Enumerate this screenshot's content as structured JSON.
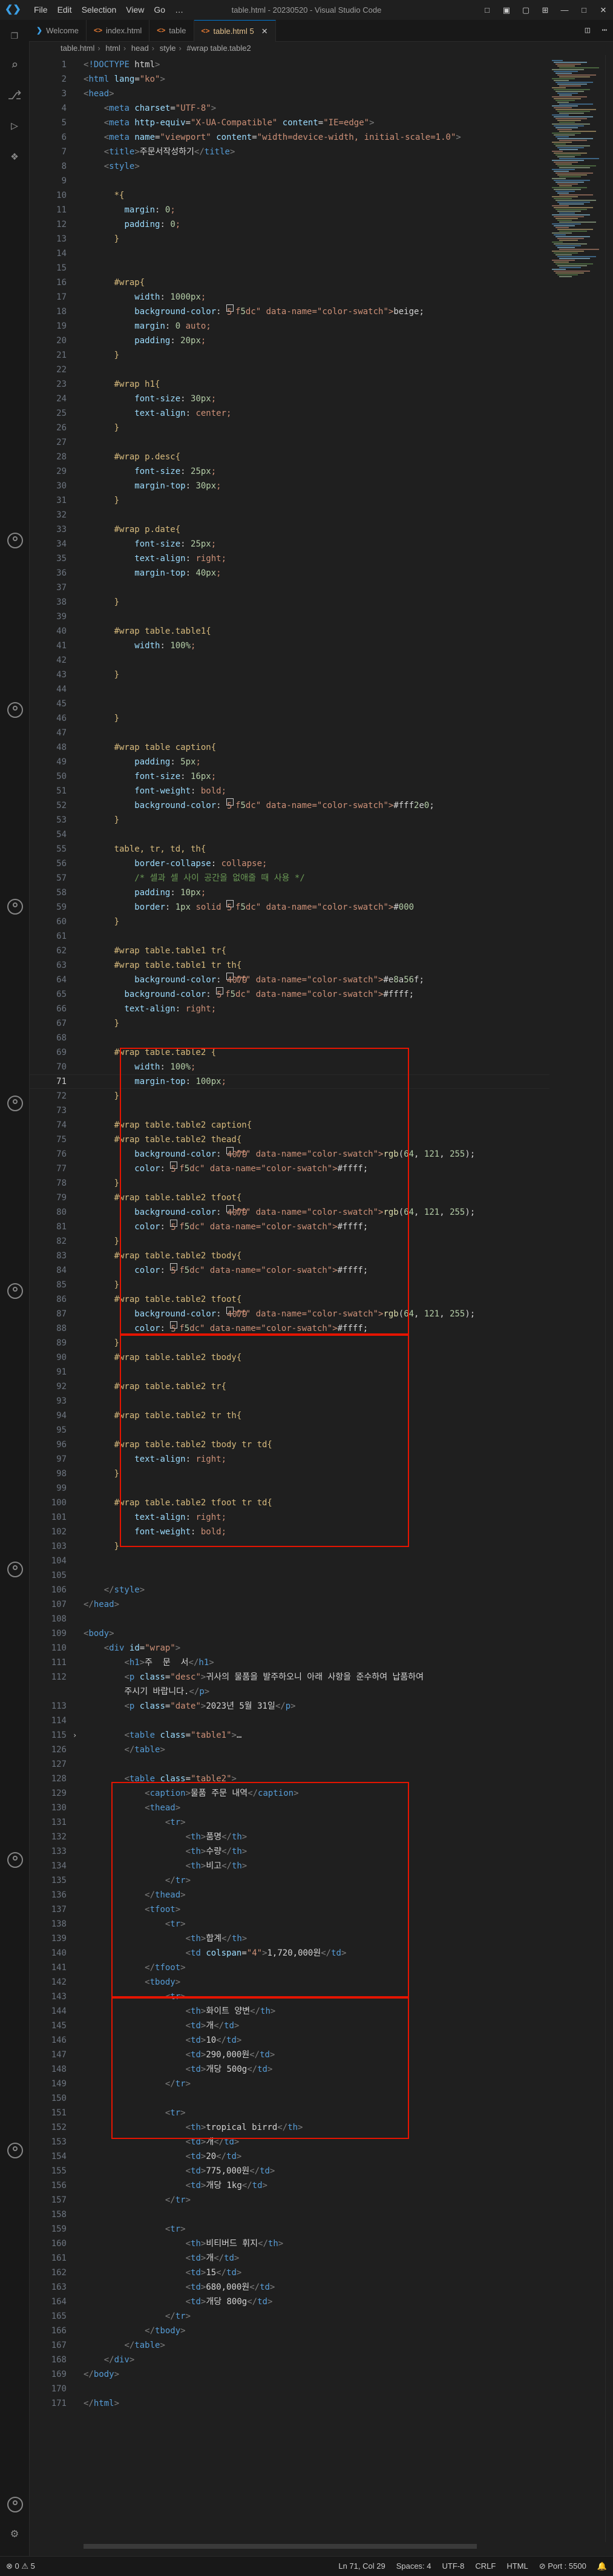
{
  "titlebar": {
    "menu": [
      "File",
      "Edit",
      "Selection",
      "View",
      "Go",
      "…"
    ],
    "title": "table.html - 20230520 - Visual Studio Code"
  },
  "tabs": [
    {
      "label": "Welcome",
      "icon": "vscode-icon"
    },
    {
      "label": "index.html",
      "icon": "html-file-icon"
    },
    {
      "label": "table",
      "icon": "html-file-icon"
    },
    {
      "label": "table.html 5",
      "icon": "html-file-icon",
      "active": true
    }
  ],
  "breadcrumb": [
    "table.html",
    "html",
    "head",
    "style",
    "#wrap table.table2"
  ],
  "editor": {
    "lines": [
      {
        "n": "1",
        "t": "<!DOCTYPE html>"
      },
      {
        "n": "2",
        "t": "<html lang=\"ko\">"
      },
      {
        "n": "3",
        "t": "<head>"
      },
      {
        "n": "4",
        "t": "    <meta charset=\"UTF-8\">"
      },
      {
        "n": "5",
        "t": "    <meta http-equiv=\"X-UA-Compatible\" content=\"IE=edge\">"
      },
      {
        "n": "6",
        "t": "    <meta name=\"viewport\" content=\"width=device-width, initial-scale=1.0\">"
      },
      {
        "n": "7",
        "t": "    <title>주문서작성하기</title>"
      },
      {
        "n": "8",
        "t": "    <style>"
      },
      {
        "n": "9",
        "t": ""
      },
      {
        "n": "10",
        "t": "      *{"
      },
      {
        "n": "11",
        "t": "        margin: 0;"
      },
      {
        "n": "12",
        "t": "        padding: 0;"
      },
      {
        "n": "13",
        "t": "      }"
      },
      {
        "n": "14",
        "t": ""
      },
      {
        "n": "15",
        "t": ""
      },
      {
        "n": "16",
        "t": "      #wrap{"
      },
      {
        "n": "17",
        "t": "          width: 1000px;"
      },
      {
        "n": "18",
        "t": "          background-color: □beige;"
      },
      {
        "n": "19",
        "t": "          margin: 0 auto;"
      },
      {
        "n": "20",
        "t": "          padding: 20px;"
      },
      {
        "n": "21",
        "t": "      }"
      },
      {
        "n": "22",
        "t": ""
      },
      {
        "n": "23",
        "t": "      #wrap h1{"
      },
      {
        "n": "24",
        "t": "          font-size: 30px;"
      },
      {
        "n": "25",
        "t": "          text-align: center;"
      },
      {
        "n": "26",
        "t": "      }"
      },
      {
        "n": "27",
        "t": ""
      },
      {
        "n": "28",
        "t": "      #wrap p.desc{"
      },
      {
        "n": "29",
        "t": "          font-size: 25px;"
      },
      {
        "n": "30",
        "t": "          margin-top: 30px;"
      },
      {
        "n": "31",
        "t": "      }"
      },
      {
        "n": "32",
        "t": ""
      },
      {
        "n": "33",
        "t": "      #wrap p.date{"
      },
      {
        "n": "34",
        "t": "          font-size: 25px;"
      },
      {
        "n": "35",
        "t": "          text-align: right;"
      },
      {
        "n": "36",
        "t": "          margin-top: 40px;"
      },
      {
        "n": "37",
        "t": ""
      },
      {
        "n": "38",
        "t": "      }"
      },
      {
        "n": "39",
        "t": ""
      },
      {
        "n": "40",
        "t": "      #wrap table.table1{"
      },
      {
        "n": "41",
        "t": "          width: 100%;"
      },
      {
        "n": "42",
        "t": ""
      },
      {
        "n": "43",
        "t": "      }"
      },
      {
        "n": "44",
        "t": ""
      },
      {
        "n": "45",
        "t": ""
      },
      {
        "n": "46",
        "t": "      }"
      },
      {
        "n": "47",
        "t": ""
      },
      {
        "n": "48",
        "t": "      #wrap table caption{"
      },
      {
        "n": "49",
        "t": "          padding: 5px;"
      },
      {
        "n": "50",
        "t": "          font-size: 16px;"
      },
      {
        "n": "51",
        "t": "          font-weight: bold;"
      },
      {
        "n": "52",
        "t": "          background-color: □#fff2e0;"
      },
      {
        "n": "53",
        "t": "      }"
      },
      {
        "n": "54",
        "t": ""
      },
      {
        "n": "55",
        "t": "      table, tr, td, th{"
      },
      {
        "n": "56",
        "t": "          border-collapse: collapse;"
      },
      {
        "n": "57",
        "t": "          /* 셀과 셀 사이 공간을 없애줄 때 사용 */"
      },
      {
        "n": "58",
        "t": "          padding: 10px;"
      },
      {
        "n": "59",
        "t": "          border: 1px solid □#000"
      },
      {
        "n": "60",
        "t": "      }"
      },
      {
        "n": "61",
        "t": ""
      },
      {
        "n": "62",
        "t": "      #wrap table.table1 tr{"
      },
      {
        "n": "63",
        "t": "      #wrap table.table1 tr th{"
      },
      {
        "n": "64",
        "t": "          background-color: ■#e8a56f;"
      },
      {
        "n": "65",
        "t": "        background-color: □#ffff;"
      },
      {
        "n": "66",
        "t": "        text-align: right;"
      },
      {
        "n": "67",
        "t": "      }"
      },
      {
        "n": "68",
        "t": ""
      },
      {
        "n": "69",
        "t": "      #wrap table.table2 {"
      },
      {
        "n": "70",
        "t": "          width: 100%;"
      },
      {
        "n": "71",
        "t": "          margin-top: 100px;"
      },
      {
        "n": "72",
        "t": "      }"
      },
      {
        "n": "73",
        "t": ""
      },
      {
        "n": "74",
        "t": "      #wrap table.table2 caption{"
      },
      {
        "n": "75",
        "t": "      #wrap table.table2 thead{"
      },
      {
        "n": "76",
        "t": "          background-color: ■rgb(64, 121, 255);"
      },
      {
        "n": "77",
        "t": "          color: □#ffff;"
      },
      {
        "n": "78",
        "t": "      }"
      },
      {
        "n": "79",
        "t": "      #wrap table.table2 tfoot{"
      },
      {
        "n": "80",
        "t": "          background-color: ■rgb(64, 121, 255);"
      },
      {
        "n": "81",
        "t": "          color: □#ffff;"
      },
      {
        "n": "82",
        "t": "      }"
      },
      {
        "n": "83",
        "t": "      #wrap table.table2 tbody{"
      },
      {
        "n": "84",
        "t": "          color: □#ffff;"
      },
      {
        "n": "85",
        "t": "      }"
      },
      {
        "n": "86",
        "t": "      #wrap table.table2 tfoot{"
      },
      {
        "n": "87",
        "t": "          background-color: ■rgb(64, 121, 255);"
      },
      {
        "n": "88",
        "t": "          color: □#ffff;"
      },
      {
        "n": "89",
        "t": "      }"
      },
      {
        "n": "90",
        "t": "      #wrap table.table2 tbody{"
      },
      {
        "n": "91",
        "t": ""
      },
      {
        "n": "92",
        "t": "      #wrap table.table2 tr{"
      },
      {
        "n": "93",
        "t": ""
      },
      {
        "n": "94",
        "t": "      #wrap table.table2 tr th{"
      },
      {
        "n": "95",
        "t": ""
      },
      {
        "n": "96",
        "t": "      #wrap table.table2 tbody tr td{"
      },
      {
        "n": "97",
        "t": "          text-align: right;"
      },
      {
        "n": "98",
        "t": "      }"
      },
      {
        "n": "99",
        "t": ""
      },
      {
        "n": "100",
        "t": "      #wrap table.table2 tfoot tr td{"
      },
      {
        "n": "101",
        "t": "          text-align: right;"
      },
      {
        "n": "102",
        "t": "          font-weight: bold;"
      },
      {
        "n": "103",
        "t": "      }"
      },
      {
        "n": "104",
        "t": ""
      },
      {
        "n": "105",
        "t": ""
      },
      {
        "n": "106",
        "t": "    </style>"
      },
      {
        "n": "107",
        "t": "</head>"
      },
      {
        "n": "108",
        "t": ""
      },
      {
        "n": "109",
        "t": "<body>"
      },
      {
        "n": "110",
        "t": "    <div id=\"wrap\">"
      },
      {
        "n": "111",
        "t": "        <h1>주  문  서</h1>"
      },
      {
        "n": "112",
        "t": "        <p class=\"desc\">귀사의 물품을 발주하오니 아래 사항을 준수하여 납품하여"
      },
      {
        "n": "",
        "t": "        주시기 바랍니다.</p>"
      },
      {
        "n": "113",
        "t": "        <p class=\"date\">2023년 5월 31일</p>"
      },
      {
        "n": "114",
        "t": ""
      },
      {
        "n": "115",
        "t": "        <table class=\"table1\">…"
      },
      {
        "n": "126",
        "t": "        </table>"
      },
      {
        "n": "127",
        "t": ""
      },
      {
        "n": "128",
        "t": "        <table class=\"table2\">"
      },
      {
        "n": "129",
        "t": "            <caption>물품 주문 내역</caption>"
      },
      {
        "n": "130",
        "t": "            <thead>"
      },
      {
        "n": "131",
        "t": "                <tr>"
      },
      {
        "n": "132",
        "t": "                    <th>품명</th>"
      },
      {
        "n": "133",
        "t": "                    <th>수량</th>"
      },
      {
        "n": "134",
        "t": "                    <th>비고</th>"
      },
      {
        "n": "135",
        "t": "                </tr>"
      },
      {
        "n": "136",
        "t": "            </thead>"
      },
      {
        "n": "137",
        "t": "            <tfoot>"
      },
      {
        "n": "138",
        "t": "                <tr>"
      },
      {
        "n": "139",
        "t": "                    <th>합계</th>"
      },
      {
        "n": "140",
        "t": "                    <td colspan=\"4\">1,720,000원</td>"
      },
      {
        "n": "141",
        "t": "            </tfoot>"
      },
      {
        "n": "142",
        "t": "            <tbody>"
      },
      {
        "n": "143",
        "t": "                <tr>"
      },
      {
        "n": "144",
        "t": "                    <th>화이트 양변</th>"
      },
      {
        "n": "145",
        "t": "                    <td>개</td>"
      },
      {
        "n": "146",
        "t": "                    <td>10</td>"
      },
      {
        "n": "147",
        "t": "                    <td>290,000원</td>"
      },
      {
        "n": "148",
        "t": "                    <td>개당 500g</td>"
      },
      {
        "n": "149",
        "t": "                </tr>"
      },
      {
        "n": "150",
        "t": ""
      },
      {
        "n": "151",
        "t": "                <tr>"
      },
      {
        "n": "152",
        "t": "                    <th>tropical birrd</th>"
      },
      {
        "n": "153",
        "t": "                    <td>개</td>"
      },
      {
        "n": "154",
        "t": "                    <td>20</td>"
      },
      {
        "n": "155",
        "t": "                    <td>775,000원</td>"
      },
      {
        "n": "156",
        "t": "                    <td>개당 1kg</td>"
      },
      {
        "n": "157",
        "t": "                </tr>"
      },
      {
        "n": "158",
        "t": ""
      },
      {
        "n": "159",
        "t": "                <tr>"
      },
      {
        "n": "160",
        "t": "                    <th>비티버드 휘지</th>"
      },
      {
        "n": "161",
        "t": "                    <td>개</td>"
      },
      {
        "n": "162",
        "t": "                    <td>15</td>"
      },
      {
        "n": "163",
        "t": "                    <td>680,000원</td>"
      },
      {
        "n": "164",
        "t": "                    <td>개당 800g</td>"
      },
      {
        "n": "165",
        "t": "                </tr>"
      },
      {
        "n": "166",
        "t": "            </tbody>"
      },
      {
        "n": "167",
        "t": "        </table>"
      },
      {
        "n": "168",
        "t": "    </div>"
      },
      {
        "n": "169",
        "t": "</body>"
      },
      {
        "n": "170",
        "t": ""
      },
      {
        "n": "171",
        "t": "</html>"
      }
    ],
    "current_line": "71"
  },
  "statusbar": {
    "left": [
      "⊗ 0  ⚠ 5"
    ],
    "right": [
      "Ln 71, Col 29",
      "Spaces: 4",
      "UTF-8",
      "CRLF",
      "HTML",
      "⊘ Port : 5500",
      "🔔"
    ]
  },
  "colors": {
    "accent": "#0078d4",
    "highlight_box": "#e51400",
    "swatch_beige": "#f5f5dc",
    "swatch_peach": "#fff2e0",
    "swatch_orange": "#e8a56f",
    "swatch_blue": "#4079ff"
  }
}
